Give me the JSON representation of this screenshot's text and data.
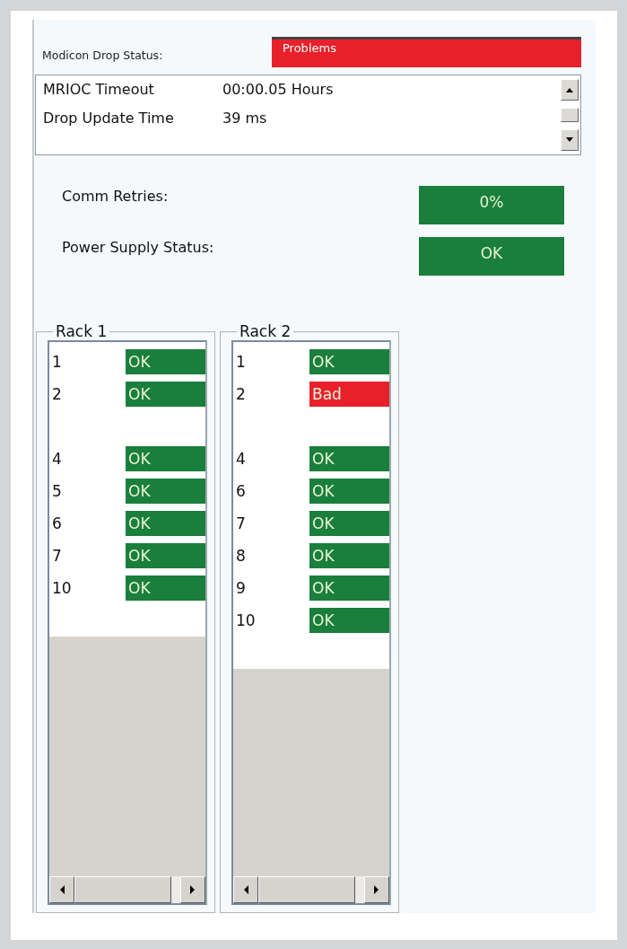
{
  "drop_status": {
    "label": "Modicon Drop Status:",
    "value": "Problems",
    "color": "#e8202a"
  },
  "info": [
    {
      "name": "MRIOC Timeout",
      "value": "00:00.05 Hours"
    },
    {
      "name": "Drop Update Time",
      "value": "39 ms"
    }
  ],
  "metrics": [
    {
      "label": "Comm Retries:",
      "value": "0%",
      "color": "#1a7f3c"
    },
    {
      "label": "Power Supply Status:",
      "value": "OK",
      "color": "#1a7f3c"
    }
  ],
  "racks": [
    {
      "title": "Rack 1",
      "slots": [
        {
          "kind": "slot",
          "slot": "1",
          "status": "OK",
          "color": "#1a7f3c"
        },
        {
          "kind": "slot",
          "slot": "2",
          "status": "OK",
          "color": "#1a7f3c"
        },
        {
          "kind": "blank"
        },
        {
          "kind": "slot",
          "slot": "4",
          "status": "OK",
          "color": "#1a7f3c"
        },
        {
          "kind": "slot",
          "slot": "5",
          "status": "OK",
          "color": "#1a7f3c"
        },
        {
          "kind": "slot",
          "slot": "6",
          "status": "OK",
          "color": "#1a7f3c"
        },
        {
          "kind": "slot",
          "slot": "7",
          "status": "OK",
          "color": "#1a7f3c"
        },
        {
          "kind": "slot",
          "slot": "10",
          "status": "OK",
          "color": "#1a7f3c"
        }
      ]
    },
    {
      "title": "Rack 2",
      "slots": [
        {
          "kind": "slot",
          "slot": "1",
          "status": "OK",
          "color": "#1a7f3c"
        },
        {
          "kind": "slot",
          "slot": "2",
          "status": "Bad",
          "color": "#e8202a"
        },
        {
          "kind": "blank"
        },
        {
          "kind": "slot",
          "slot": "4",
          "status": "OK",
          "color": "#1a7f3c"
        },
        {
          "kind": "slot",
          "slot": "6",
          "status": "OK",
          "color": "#1a7f3c"
        },
        {
          "kind": "slot",
          "slot": "7",
          "status": "OK",
          "color": "#1a7f3c"
        },
        {
          "kind": "slot",
          "slot": "8",
          "status": "OK",
          "color": "#1a7f3c"
        },
        {
          "kind": "slot",
          "slot": "9",
          "status": "OK",
          "color": "#1a7f3c"
        },
        {
          "kind": "slot",
          "slot": "10",
          "status": "OK",
          "color": "#1a7f3c"
        }
      ]
    }
  ]
}
